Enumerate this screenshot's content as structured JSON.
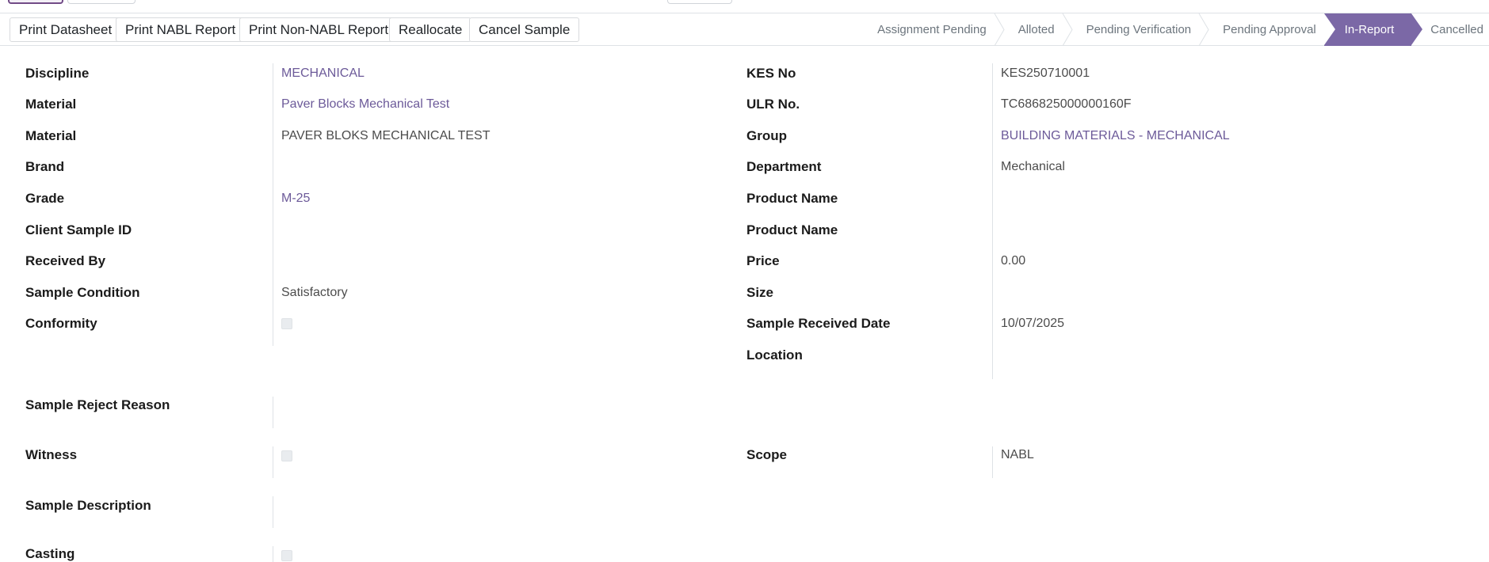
{
  "actions": {
    "print_datasheet": "Print Datasheet",
    "print_nabl": "Print NABL Report",
    "print_non_nabl": "Print Non-NABL Report",
    "reallocate": "Reallocate",
    "cancel_sample": "Cancel Sample"
  },
  "stages": [
    "Assignment Pending",
    "Alloted",
    "Pending Verification",
    "Pending Approval",
    "In-Report",
    "Cancelled"
  ],
  "active_stage": "In-Report",
  "left": {
    "discipline": {
      "label": "Discipline",
      "value": "MECHANICAL"
    },
    "material_1": {
      "label": "Material",
      "value": "Paver Blocks Mechanical Test"
    },
    "material_2": {
      "label": "Material",
      "value": "PAVER BLOKS MECHANICAL TEST"
    },
    "brand": {
      "label": "Brand",
      "value": ""
    },
    "grade": {
      "label": "Grade",
      "value": "M-25"
    },
    "client_sample_id": {
      "label": "Client Sample ID",
      "value": ""
    },
    "received_by": {
      "label": "Received By",
      "value": ""
    },
    "sample_condition": {
      "label": "Sample Condition",
      "value": "Satisfactory"
    },
    "conformity": {
      "label": "Conformity",
      "checked": false
    }
  },
  "right": {
    "kes_no": {
      "label": "KES No",
      "value": "KES250710001"
    },
    "ulr_no": {
      "label": "ULR No.",
      "value": "TC686825000000160F"
    },
    "group": {
      "label": "Group",
      "value": "BUILDING MATERIALS - MECHANICAL"
    },
    "department": {
      "label": "Department",
      "value": "Mechanical"
    },
    "product_name_1": {
      "label": "Product Name",
      "value": ""
    },
    "product_name_2": {
      "label": "Product Name",
      "value": ""
    },
    "price": {
      "label": "Price",
      "value": "0.00"
    },
    "size": {
      "label": "Size",
      "value": ""
    },
    "sample_received_date": {
      "label": "Sample Received Date",
      "value": "10/07/2025"
    },
    "location": {
      "label": "Location",
      "value": ""
    }
  },
  "sample_reject_reason": {
    "label": "Sample Reject Reason",
    "value": ""
  },
  "witness": {
    "label": "Witness",
    "checked": false
  },
  "scope": {
    "label": "Scope",
    "value": "NABL"
  },
  "sample_description": {
    "label": "Sample Description",
    "value": ""
  },
  "casting": {
    "label": "Casting",
    "checked": false
  }
}
